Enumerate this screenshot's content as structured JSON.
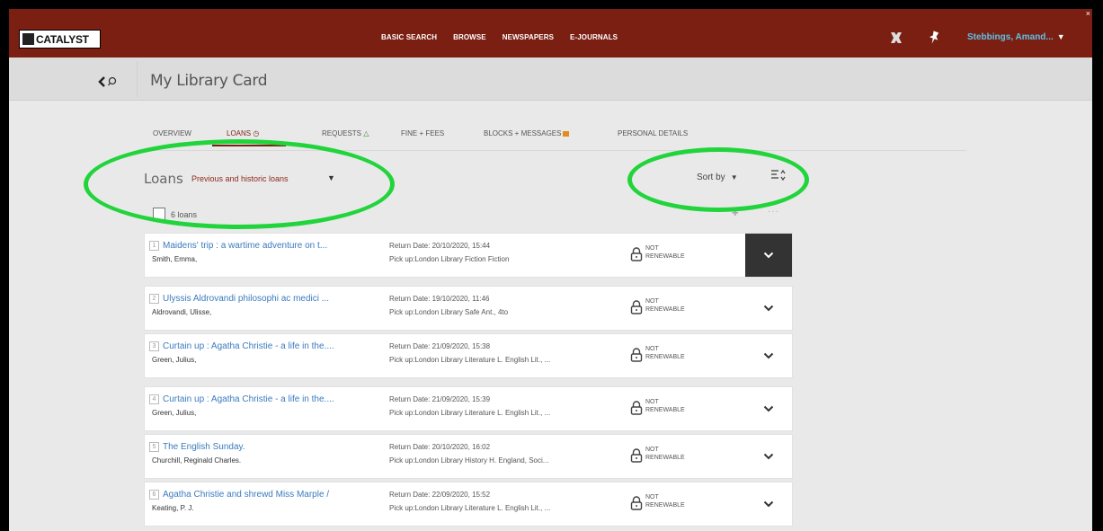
{
  "header": {
    "logo_text": "CATALYST",
    "nav": [
      "BASIC SEARCH",
      "BROWSE",
      "NEWSPAPERS",
      "E-JOURNALS"
    ],
    "user_name": "Stebbings, Amand...",
    "brand_color": "#7a1f12"
  },
  "subheader": {
    "page_title": "My Library Card"
  },
  "tabs": [
    {
      "label": "OVERVIEW",
      "active": false
    },
    {
      "label": "LOANS",
      "active": true
    },
    {
      "label": "REQUESTS",
      "active": false
    },
    {
      "label": "FINE + FEES",
      "active": false
    },
    {
      "label": "BLOCKS + MESSAGES",
      "active": false
    },
    {
      "label": "PERSONAL DETAILS",
      "active": false
    }
  ],
  "loans": {
    "title": "Loans",
    "filter_label": "Previous and historic loans",
    "sort_label": "Sort by",
    "count_label": "6 loans",
    "status_line1": "NOT",
    "status_line2": "RENEWABLE",
    "items": [
      {
        "num": "1",
        "title": "Maidens' trip : a wartime adventure on t...",
        "author": "Smith, Emma,",
        "return_date": "Return Date: 20/10/2020, 15:44",
        "pickup": "Pick up:London Library Fiction Fiction"
      },
      {
        "num": "2",
        "title": "Ulyssis Aldrovandi philosophi ac medici ...",
        "author": "Aldrovandi, Ulisse,",
        "return_date": "Return Date: 19/10/2020, 11:46",
        "pickup": "Pick up:London Library Safe Ant., 4to"
      },
      {
        "num": "3",
        "title": "Curtain up : Agatha Christie - a life in the....",
        "author": "Green, Julius,",
        "return_date": "Return Date: 21/09/2020, 15:38",
        "pickup": "Pick up:London Library Literature L. English Lit., ..."
      },
      {
        "num": "4",
        "title": "Curtain up : Agatha Christie - a life in the....",
        "author": "Green, Julius,",
        "return_date": "Return Date: 21/09/2020, 15:39",
        "pickup": "Pick up:London Library Literature L. English Lit., ..."
      },
      {
        "num": "5",
        "title": "The English Sunday.",
        "author": "Churchill, Reginald Charles.",
        "return_date": "Return Date: 20/10/2020, 16:02",
        "pickup": "Pick up:London Library History H. England, Soci..."
      },
      {
        "num": "6",
        "title": "Agatha Christie and shrewd Miss Marple /",
        "author": "Keating, P. J.",
        "return_date": "Return Date: 22/09/2020, 15:52",
        "pickup": "Pick up:London Library Literature L. English Lit., ..."
      }
    ]
  },
  "annotation_color": "#22d43c"
}
